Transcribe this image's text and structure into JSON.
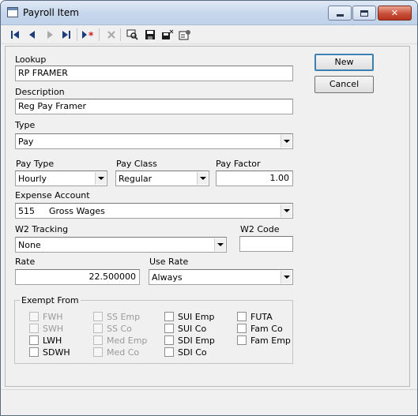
{
  "window": {
    "title": "Payroll Item"
  },
  "toolbar": {
    "icons": [
      "first-record-icon",
      "previous-record-icon",
      "next-record-icon",
      "last-record-icon",
      "new-record-icon",
      "delete-record-icon",
      "lookup-icon",
      "save-icon",
      "close-record-icon",
      "properties-icon"
    ]
  },
  "form": {
    "lookup_label": "Lookup",
    "lookup_value": "RP FRAMER",
    "description_label": "Description",
    "description_value": "Reg Pay Framer",
    "type_label": "Type",
    "type_value": "Pay",
    "pay_type_label": "Pay Type",
    "pay_type_value": "Hourly",
    "pay_class_label": "Pay Class",
    "pay_class_value": "Regular",
    "pay_factor_label": "Pay Factor",
    "pay_factor_value": "1.00",
    "expense_account_label": "Expense Account",
    "expense_account_number": "515",
    "expense_account_name": "Gross Wages",
    "w2_tracking_label": "W2 Tracking",
    "w2_tracking_value": "None",
    "w2_code_label": "W2 Code",
    "w2_code_value": "",
    "rate_label": "Rate",
    "rate_value": "22.500000",
    "use_rate_label": "Use Rate",
    "use_rate_value": "Always"
  },
  "buttons": {
    "new_label": "New",
    "cancel_label": "Cancel"
  },
  "exempt": {
    "title": "Exempt From",
    "items": [
      {
        "label": "FWH",
        "enabled": false,
        "checked": false
      },
      {
        "label": "SWH",
        "enabled": false,
        "checked": false
      },
      {
        "label": "LWH",
        "enabled": true,
        "checked": false
      },
      {
        "label": "SDWH",
        "enabled": true,
        "checked": false
      },
      {
        "label": "SS Emp",
        "enabled": false,
        "checked": false
      },
      {
        "label": "SS Co",
        "enabled": false,
        "checked": false
      },
      {
        "label": "Med Emp",
        "enabled": false,
        "checked": false
      },
      {
        "label": "Med Co",
        "enabled": false,
        "checked": false
      },
      {
        "label": "SUI Emp",
        "enabled": true,
        "checked": false
      },
      {
        "label": "SUI Co",
        "enabled": true,
        "checked": false
      },
      {
        "label": "SDI Emp",
        "enabled": true,
        "checked": false
      },
      {
        "label": "SDI Co",
        "enabled": true,
        "checked": false
      },
      {
        "label": "FUTA",
        "enabled": true,
        "checked": false
      },
      {
        "label": "Fam Co",
        "enabled": true,
        "checked": false
      },
      {
        "label": "Fam Emp",
        "enabled": true,
        "checked": false
      }
    ]
  }
}
